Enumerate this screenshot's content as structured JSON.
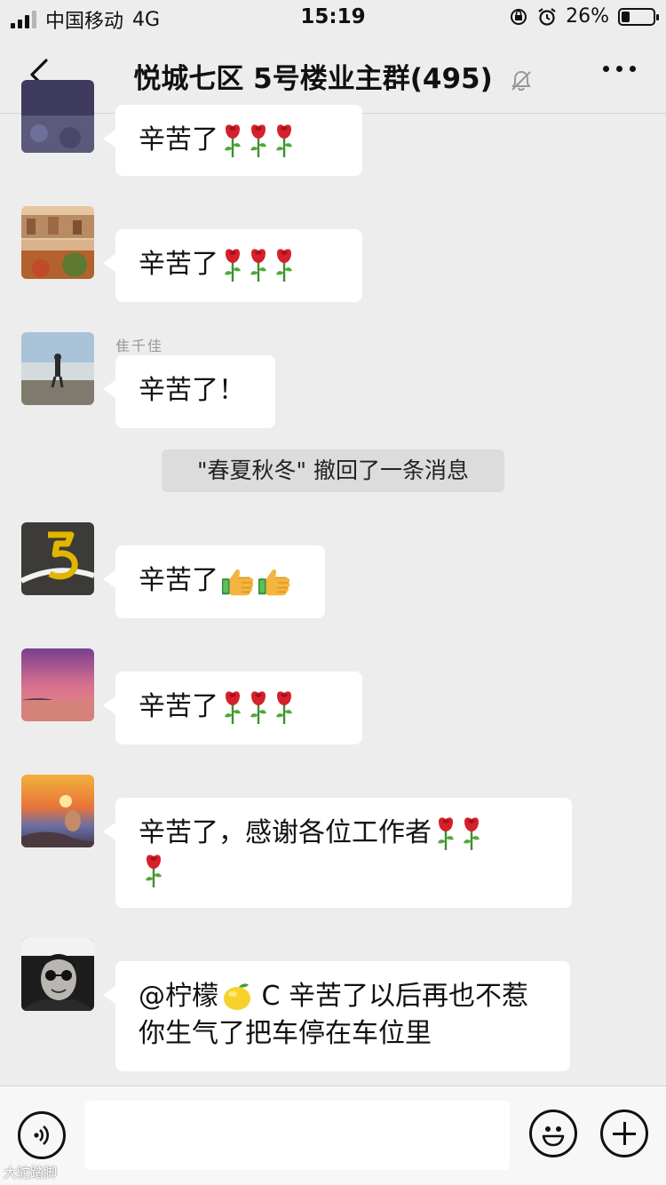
{
  "status_bar": {
    "carrier": "中国移动",
    "network": "4G",
    "time": "15:19",
    "battery": "26%",
    "battery_level": 0.26
  },
  "header": {
    "title": "悦城七区 5号楼业主群(495)",
    "icons": [
      "back-chevron-icon",
      "mute-bell-icon",
      "more-icon"
    ]
  },
  "messages": [
    {
      "sender": "",
      "text": "辛苦了",
      "emoji": [
        "rose",
        "rose",
        "rose"
      ]
    },
    {
      "sender": "",
      "text": "辛苦了",
      "emoji": [
        "rose",
        "rose",
        "rose"
      ]
    },
    {
      "sender": "隹千佳",
      "text": "辛苦了！",
      "emoji": []
    },
    {
      "sender": "",
      "text": "辛苦了",
      "emoji": [
        "thumbs-up",
        "thumbs-up"
      ]
    },
    {
      "sender": "",
      "text": "辛苦了",
      "emoji": [
        "rose",
        "rose",
        "rose"
      ]
    },
    {
      "sender": "",
      "text": "辛苦了，感谢各位工作者",
      "emoji": [
        "rose",
        "rose",
        "rose"
      ]
    },
    {
      "sender": "",
      "text_before": "@柠檬",
      "emoji": [
        "lemon"
      ],
      "text_after": " C 辛苦了以后再也不惹你生气了把车停在车位里"
    }
  ],
  "system_notice": "\"春夏秋冬\" 撤回了一条消息",
  "input_bar": {
    "placeholder": "",
    "icons": [
      "voice-icon",
      "emoji-icon",
      "plus-icon"
    ]
  },
  "watermark": "大驼踏脚"
}
